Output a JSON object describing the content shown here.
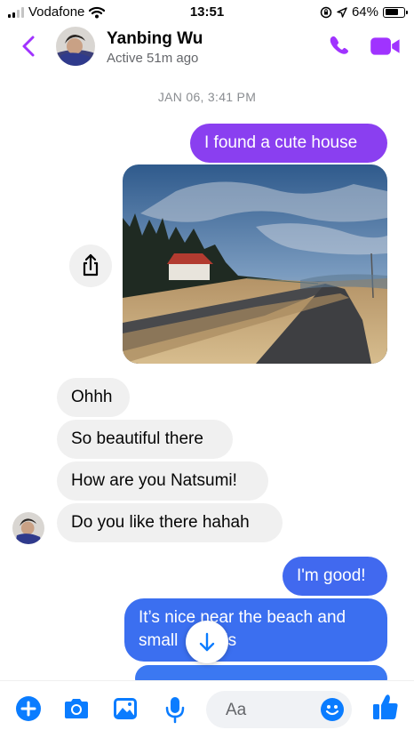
{
  "status_bar": {
    "carrier": "Vodafone",
    "time": "13:51",
    "battery": "64%"
  },
  "header": {
    "contact_name": "Yanbing Wu",
    "contact_status": "Active 51m ago"
  },
  "thread": {
    "date_separator": "JAN 06, 3:41 PM",
    "messages": [
      {
        "text": "I found a cute house"
      },
      {
        "text": "Ohhh"
      },
      {
        "text": "So beautiful there"
      },
      {
        "text": "How are you Natsumi!"
      },
      {
        "text": "Do you like there hahah"
      },
      {
        "text": "I'm good!"
      },
      {
        "text_line1": "It’s nice near the beach and",
        "text_line2": "small",
        "text_line2_tail": "ls"
      }
    ]
  },
  "composer": {
    "placeholder": "Aa"
  },
  "colors": {
    "accent": "#a033ff",
    "outgoing_top": "#8a3ff0",
    "outgoing_bottom": "#3b6ff0",
    "incoming": "#f0f0f0",
    "composer_icon": "#0a7cff"
  },
  "icons": [
    "back-chevron-icon",
    "phone-icon",
    "video-camera-icon",
    "share-icon",
    "arrow-down-icon",
    "plus-icon",
    "camera-icon",
    "photo-icon",
    "microphone-icon",
    "emoji-icon",
    "thumbs-up-icon"
  ]
}
